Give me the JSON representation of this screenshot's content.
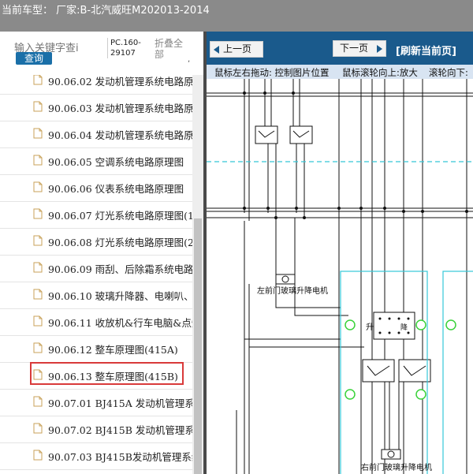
{
  "header": {
    "title": "当前车型：  厂家:B-北汽威旺M202013-2014"
  },
  "search": {
    "placeholder": "输入关键字查i",
    "button_label": "查询",
    "code": "PC.160-29107",
    "fold_label": "折叠全部",
    "fold_mark": ", "
  },
  "list": {
    "items": [
      {
        "label": "90.06.02 发动机管理系统电路原"
      },
      {
        "label": "90.06.03 发动机管理系统电路原"
      },
      {
        "label": "90.06.04 发动机管理系统电路原"
      },
      {
        "label": "90.06.05 空调系统电路原理图"
      },
      {
        "label": "90.06.06 仪表系统电路原理图"
      },
      {
        "label": "90.06.07 灯光系统电路原理图(1)"
      },
      {
        "label": "90.06.08 灯光系统电路原理图(2)"
      },
      {
        "label": "90.06.09 雨刮、后除霜系统电路"
      },
      {
        "label": "90.06.10 玻璃升降器、电喇叭、"
      },
      {
        "label": "90.06.11 收放机&行车电脑&点烟"
      },
      {
        "label": "90.06.12 整车原理图(415A)"
      },
      {
        "label": "90.06.13 整车原理图(415B)"
      },
      {
        "label": "90.07.01 BJ415A 发动机管理系统"
      },
      {
        "label": "90.07.02 BJ415B 发动机管理系统"
      },
      {
        "label": "90.07.03 BJ415B发动机管理系统"
      }
    ],
    "selected_index": 11
  },
  "viewer": {
    "prev_label": "上一页",
    "next_label": "下一页",
    "refresh_label": "[刷新当前页]",
    "hint_drag": "鼠标左右拖动: 控制图片位置",
    "hint_zoom_in": "鼠标滚轮向上:放大",
    "hint_zoom_out": "滚轮向下:",
    "diagram_labels": {
      "left_motor": "左前门玻璃升降电机",
      "right_motor": "右前门玻璃升降电机",
      "switch_up": "升",
      "switch_down": "降"
    }
  },
  "colors": {
    "top_bar": "#8a8a8a",
    "viewer_toolbar": "#1a5a8c",
    "hint_bar": "#d8e4f2",
    "selection_border": "#d93a3a",
    "search_button": "#1a6fa8",
    "diagram_cyan": "#35c8d8",
    "diagram_green": "#3ad23a"
  }
}
